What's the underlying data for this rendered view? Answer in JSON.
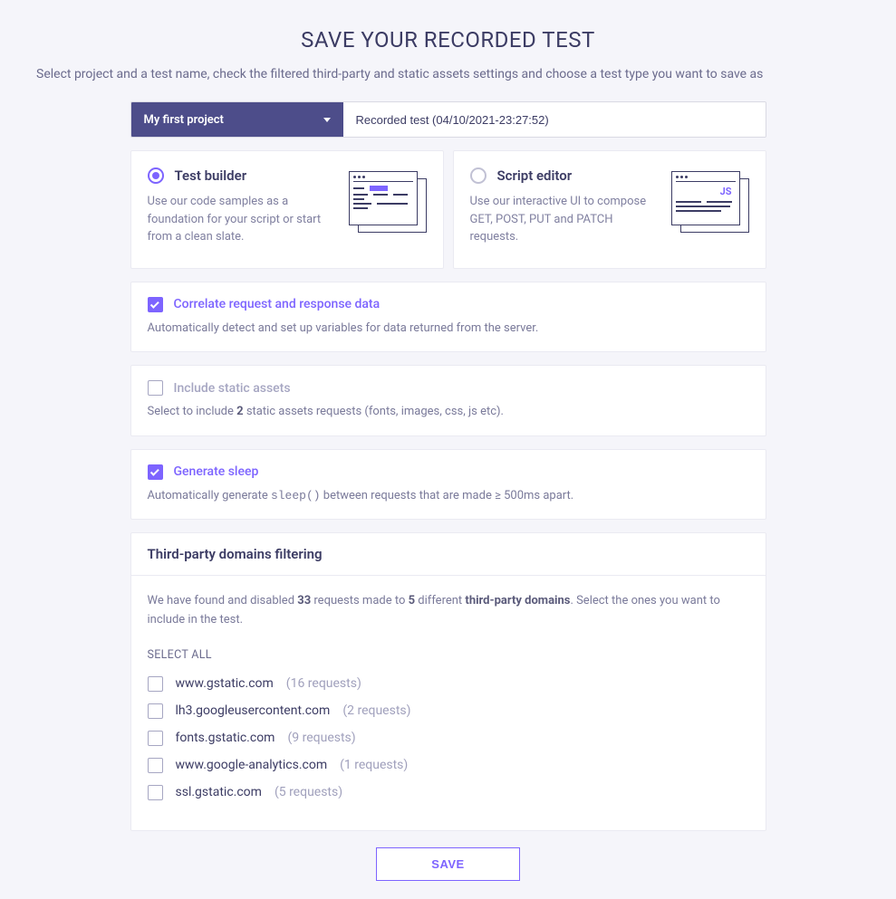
{
  "title": "SAVE YOUR RECORDED TEST",
  "subtitle": "Select project and a test name, check the filtered third-party and static assets settings and choose a test type you want to save as",
  "project": {
    "selected": "My first project"
  },
  "test_name": "Recorded test (04/10/2021-23:27:52)",
  "type_options": {
    "test_builder": {
      "title": "Test builder",
      "desc": "Use our code samples as a foundation for your script or start from a clean slate.",
      "selected": true
    },
    "script_editor": {
      "title": "Script editor",
      "desc": "Use our interactive UI to compose GET, POST, PUT and PATCH requests.",
      "selected": false
    }
  },
  "options": {
    "correlate": {
      "label": "Correlate request and response data",
      "desc": "Automatically detect and set up variables for data returned from the server.",
      "checked": true
    },
    "static_assets": {
      "label": "Include static assets",
      "desc_prefix": "Select to include ",
      "count": "2",
      "desc_suffix": " static assets requests (fonts, images, css, js etc).",
      "checked": false
    },
    "generate_sleep": {
      "label": "Generate sleep",
      "desc_prefix": "Automatically generate ",
      "code": "sleep()",
      "desc_suffix": " between requests that are made ≥ 500ms apart.",
      "checked": true
    }
  },
  "third_party": {
    "heading": "Third-party domains filtering",
    "intro_1": "We have found and disabled ",
    "requests_count": "33",
    "intro_2": " requests made to ",
    "domains_count": "5",
    "intro_3": " different ",
    "bold_phrase": "third-party domains",
    "intro_4": ". Select the ones you want to include in the test.",
    "select_all": "SELECT ALL",
    "domains": [
      {
        "name": "www.gstatic.com",
        "count": "(16 requests)"
      },
      {
        "name": "lh3.googleusercontent.com",
        "count": "(2 requests)"
      },
      {
        "name": "fonts.gstatic.com",
        "count": "(9 requests)"
      },
      {
        "name": "www.google-analytics.com",
        "count": "(1 requests)"
      },
      {
        "name": "ssl.gstatic.com",
        "count": "(5 requests)"
      }
    ]
  },
  "save_button": "SAVE"
}
